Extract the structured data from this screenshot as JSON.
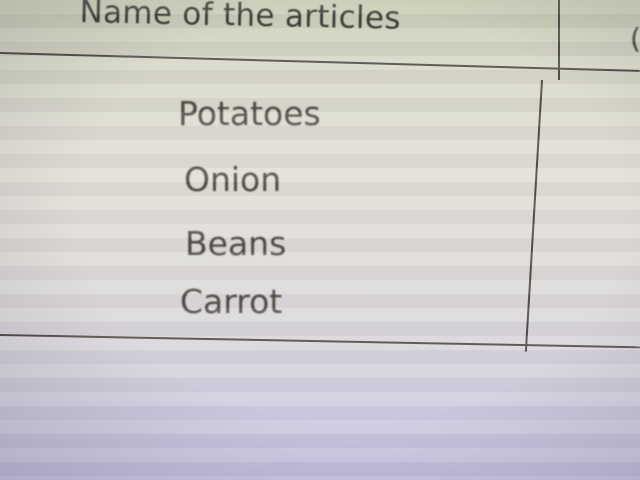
{
  "table": {
    "header": {
      "name_column": "Name of the articles",
      "next_column_partial": "("
    },
    "rows": [
      {
        "name": "Potatoes"
      },
      {
        "name": "Onion"
      },
      {
        "name": "Beans"
      },
      {
        "name": "Carrot"
      }
    ]
  },
  "colors": {
    "text": "#3b3a34",
    "rule": "#4e4a44"
  }
}
